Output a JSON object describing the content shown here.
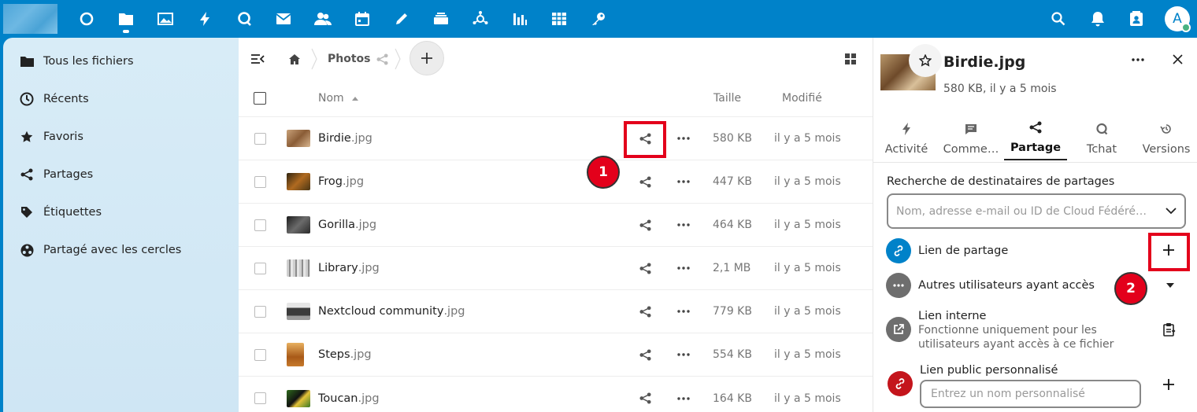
{
  "colors": {
    "brand": "#0082c9",
    "annotation": "#e3001b",
    "nav_bg": "#d3e9f6"
  },
  "top_apps": [
    "dashboard-icon",
    "files-icon",
    "photos-icon",
    "activity-icon",
    "talk-icon",
    "mail-icon",
    "contacts-icon",
    "calendar-icon",
    "notes-icon",
    "deck-icon",
    "circles-icon",
    "analytics-icon",
    "tables-icon",
    "passwords-icon"
  ],
  "user": {
    "avatar_letter": "A"
  },
  "nav": {
    "items": [
      {
        "label": "Tous les fichiers",
        "icon": "folder-icon"
      },
      {
        "label": "Récents",
        "icon": "clock-icon"
      },
      {
        "label": "Favoris",
        "icon": "star-icon"
      },
      {
        "label": "Partages",
        "icon": "share-icon"
      },
      {
        "label": "Étiquettes",
        "icon": "tag-icon"
      },
      {
        "label": "Partagé avec les cercles",
        "icon": "circles-icon"
      }
    ]
  },
  "breadcrumb": {
    "folder": "Photos"
  },
  "table": {
    "headers": {
      "name": "Nom",
      "size": "Taille",
      "modified": "Modifié"
    },
    "rows": [
      {
        "name": "Birdie",
        "ext": ".jpg",
        "size": "580 KB",
        "modified": "il y a 5 mois"
      },
      {
        "name": "Frog",
        "ext": ".jpg",
        "size": "447 KB",
        "modified": "il y a 5 mois"
      },
      {
        "name": "Gorilla",
        "ext": ".jpg",
        "size": "464 KB",
        "modified": "il y a 5 mois"
      },
      {
        "name": "Library",
        "ext": ".jpg",
        "size": "2,1 MB",
        "modified": "il y a 5 mois"
      },
      {
        "name": "Nextcloud community",
        "ext": ".jpg",
        "size": "779 KB",
        "modified": "il y a 5 mois"
      },
      {
        "name": "Steps",
        "ext": ".jpg",
        "size": "554 KB",
        "modified": "il y a 5 mois"
      },
      {
        "name": "Toucan",
        "ext": ".jpg",
        "size": "164 KB",
        "modified": "il y a 5 mois"
      }
    ]
  },
  "sidebar": {
    "file_name": "Birdie.jpg",
    "file_meta": "580 KB, il y a 5 mois",
    "tabs": [
      "Activité",
      "Comme…",
      "Partage",
      "Tchat",
      "Versions"
    ],
    "search_label": "Recherche de destinataires de partages",
    "search_placeholder": "Nom, adresse e-mail ou ID de Cloud Fédéré…",
    "share_link_label": "Lien de partage",
    "others_label": "Autres utilisateurs ayant accès",
    "internal_title": "Lien interne",
    "internal_desc1": "Fonctionne uniquement pour les",
    "internal_desc2": "utilisateurs ayant accès à ce fichier",
    "custom_link_title": "Lien public personnalisé",
    "custom_link_placeholder": "Entrez un nom personnalisé"
  },
  "annotations": {
    "badge1": "1",
    "badge2": "2"
  }
}
